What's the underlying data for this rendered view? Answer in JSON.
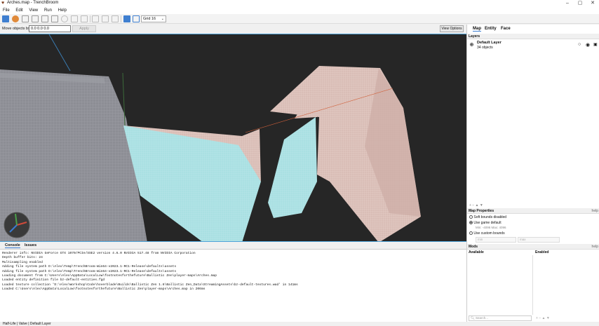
{
  "window": {
    "title": "Arches.map - TrenchBroom",
    "controls": [
      "–",
      "▢",
      "✕"
    ]
  },
  "menu": [
    "File",
    "Edit",
    "View",
    "Run",
    "Help"
  ],
  "toolbar": {
    "grid_select": "Grid 16"
  },
  "move_bar": {
    "label": "Move objects by",
    "value": "0.0 0.0 0.0",
    "apply_label": "Apply",
    "view_options_label": "View Options"
  },
  "console": {
    "tabs": [
      "Console",
      "Issues"
    ],
    "lines": [
      "Renderer info: NVIDIA GeForce GTX 1070/PCIe/SSE2 version 4.6.0 NVIDIA 517.48 from NVIDIA Corporation",
      "Depth buffer bits: 24",
      "Multisampling enabled",
      "Adding file system path D:\\Alex\\Temp\\TrenchBroom-Win64-v2023.1-RC1-Release\\defaults\\assets",
      "Adding file system path D:\\Alex\\Temp\\TrenchBroom-Win64-v2023.1-RC1-Release\\defaults\\assets",
      "Loading document from C:\\Users\\Alex\\AppData\\LocalLow\\footnotesforthefuture\\Ballistic Zen\\player-maps\\Arches.map",
      "Loaded entity definition file bz-default-entities.fgd",
      "Loaded texture collection 'D:\\Alex\\Workshop\\Code\\hoverblade\\Builds\\Ballistic Zen 1.6\\Ballistic Zen_Data\\StreamingAssets\\bz-default-textures.wad' in 141ms",
      "Loaded C:\\Users\\Alex\\AppData\\LocalLow\\footnotesforthefuture\\Ballistic Zen\\player-maps\\Arches.map in 206ms"
    ]
  },
  "status_bar": "Half-Life  |  Valve  |  Default Layer",
  "right_panel": {
    "tabs": [
      "Map",
      "Entity",
      "Face"
    ],
    "layers_header": "Layers",
    "layer": {
      "name": "Default Layer",
      "count": "34 objects"
    },
    "layer_footer": "+  –  ▲  ▼",
    "map_properties": {
      "header": "Map Properties",
      "help": "help",
      "options": [
        "Soft bounds disabled",
        "Use game default",
        "Use custom bounds"
      ],
      "game_default_detail": "Min: -4096  Max: 4096",
      "min_placeholder": "min",
      "max_placeholder": "max"
    },
    "mods": {
      "header": "Mods",
      "help": "help",
      "available": "Available",
      "enabled": "Enabled",
      "search_placeholder": "Search...",
      "footer": "+  –  ▲  ▼"
    }
  },
  "colors": {
    "viewport_bg": "#262626",
    "selection_blue": "#4da3d8",
    "brush_cyan": "#aee3e6",
    "brush_pink": "#e7c9c4",
    "floor_gray": "#8e8f96"
  }
}
